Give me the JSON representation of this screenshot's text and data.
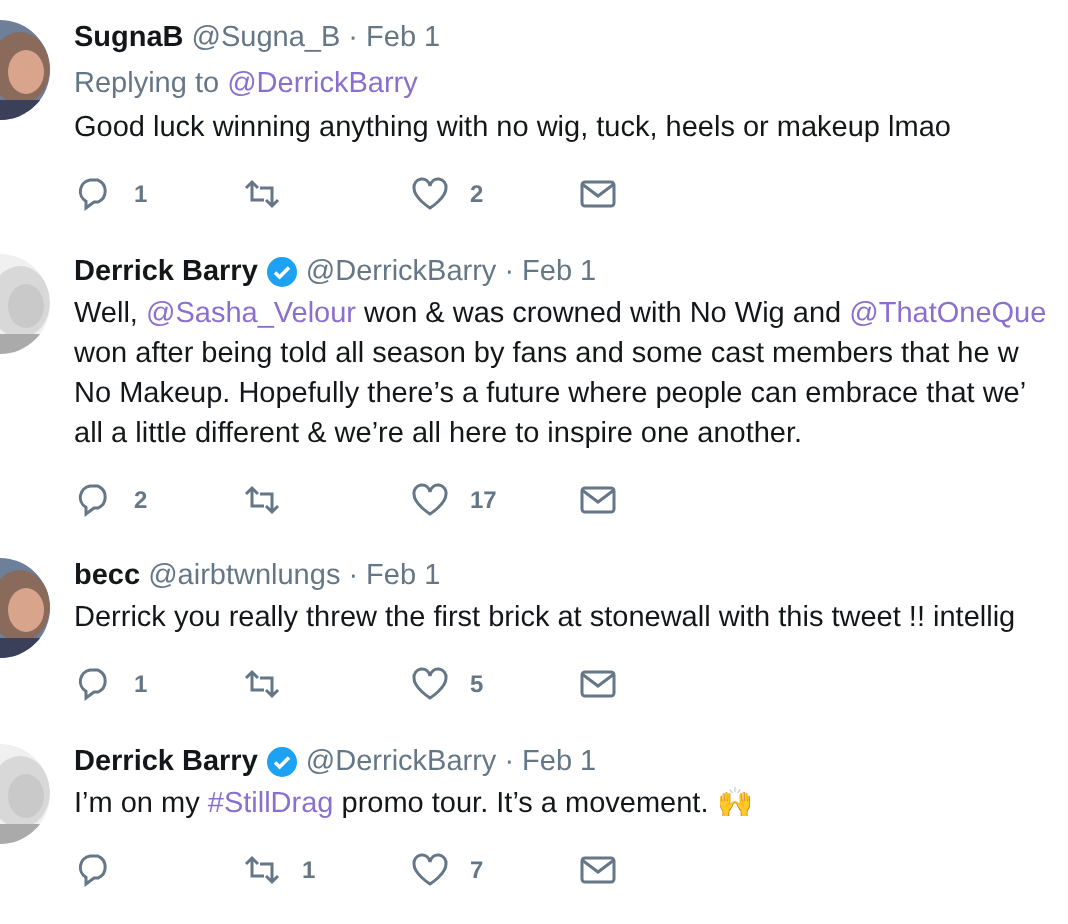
{
  "tweets": [
    {
      "name": "SugnaB",
      "verified": false,
      "handle": "@Sugna_B",
      "time": "· Feb 1",
      "replying": {
        "label": "Replying to",
        "mention": "@DerrickBarry"
      },
      "lines": [
        [
          {
            "kind": "text",
            "text": "Good luck winning anything with no wig, tuck, heels or makeup lmao"
          }
        ]
      ],
      "actions": {
        "replies": "1",
        "likes": "2"
      }
    },
    {
      "name": "Derrick Barry",
      "verified": true,
      "handle": "@DerrickBarry",
      "time": "· Feb 1",
      "lines": [
        [
          {
            "kind": "text",
            "text": "Well, "
          },
          {
            "kind": "link",
            "text": "@Sasha_Velour"
          },
          {
            "kind": "text",
            "text": " won & was crowned with No Wig and "
          },
          {
            "kind": "link",
            "text": "@ThatOneQue"
          }
        ],
        [
          {
            "kind": "text",
            "text": "won after being told all season by fans and some cast members that he w"
          }
        ],
        [
          {
            "kind": "text",
            "text": "No Makeup. Hopefully there’s a future where people can embrace that we’"
          }
        ],
        [
          {
            "kind": "text",
            "text": "all a little different & we’re all here to inspire one another."
          }
        ]
      ],
      "actions": {
        "replies": "2",
        "likes": "17"
      }
    },
    {
      "name": "becc",
      "verified": false,
      "handle": "@airbtwnlungs",
      "time": "· Feb 1",
      "lines": [
        [
          {
            "kind": "text",
            "text": "Derrick you really threw the first brick at stonewall with this tweet !! intellig"
          }
        ]
      ],
      "actions": {
        "replies": "1",
        "likes": "5"
      }
    },
    {
      "name": "Derrick Barry",
      "verified": true,
      "handle": "@DerrickBarry",
      "time": "· Feb 1",
      "lines": [
        [
          {
            "kind": "text",
            "text": "I’m on my "
          },
          {
            "kind": "link",
            "text": "#StillDrag"
          },
          {
            "kind": "text",
            "text": " promo tour. It’s a movement. 🙌"
          }
        ]
      ],
      "actions": {
        "retweets": "1",
        "likes": "7"
      }
    }
  ]
}
